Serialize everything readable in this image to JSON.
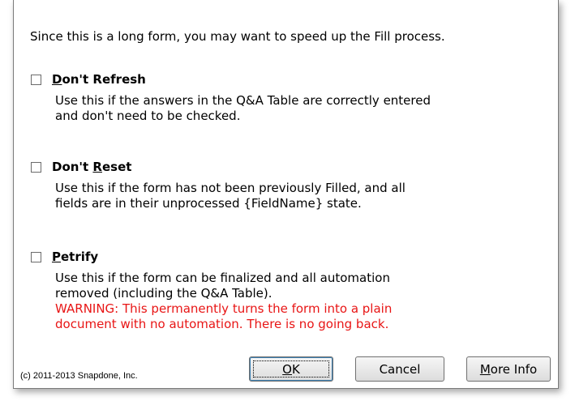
{
  "intro": "Since this is a long form, you may want to speed up the Fill process.",
  "options": [
    {
      "title_prefix": "",
      "title_mnemonic": "D",
      "title_suffix": "on't Refresh",
      "checked": false,
      "desc": [
        "Use this if the answers in the Q&A Table are correctly entered",
        "and don't need to be checked."
      ]
    },
    {
      "title_prefix": "Don't ",
      "title_mnemonic": "R",
      "title_suffix": "eset",
      "checked": false,
      "desc": [
        "Use this if the form has not been previously Filled, and all",
        "fields are in their unprocessed {FieldName} state."
      ]
    },
    {
      "title_prefix": "",
      "title_mnemonic": "P",
      "title_suffix": "etrify",
      "checked": false,
      "desc": [
        "Use this if the form can be finalized and all automation",
        "removed (including the Q&A Table)."
      ],
      "warning": [
        "WARNING:  This permanently turns the form into a plain",
        "document with no automation.  There is no going back."
      ]
    }
  ],
  "copyright": "(c) 2011-2013 Snapdone, Inc.",
  "buttons": {
    "ok_mnemonic": "O",
    "ok_rest": "K",
    "cancel": "Cancel",
    "more_mnemonic": "M",
    "more_rest": "ore Info"
  },
  "colors": {
    "warning": "#e81515",
    "focus": "#3c7fb1"
  }
}
